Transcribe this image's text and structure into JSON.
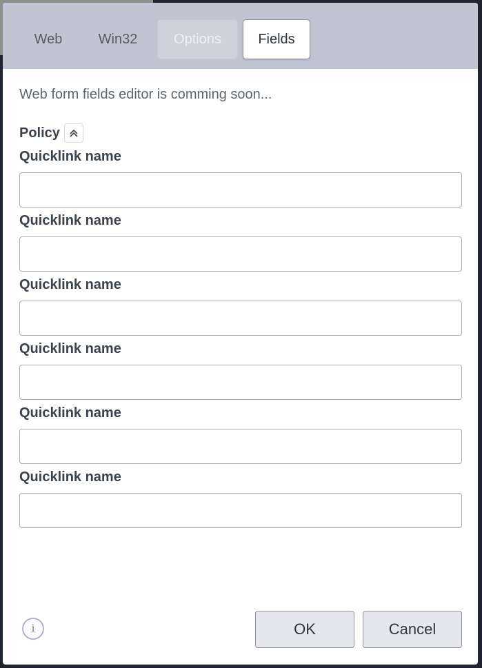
{
  "tabs": [
    {
      "label": "Web"
    },
    {
      "label": "Win32"
    },
    {
      "label": "Options"
    },
    {
      "label": "Fields"
    }
  ],
  "notice": "Web form fields editor is comming soon...",
  "policy": {
    "label": "Policy",
    "collapse_icon": "chevrons-up-icon"
  },
  "fields": [
    {
      "label": "Quicklink name",
      "value": ""
    },
    {
      "label": "Quicklink name",
      "value": ""
    },
    {
      "label": "Quicklink name",
      "value": ""
    },
    {
      "label": "Quicklink name",
      "value": ""
    },
    {
      "label": "Quicklink name",
      "value": ""
    },
    {
      "label": "Quicklink name",
      "value": ""
    }
  ],
  "footer": {
    "info_icon": "info-icon",
    "info_glyph": "i",
    "ok_label": "OK",
    "cancel_label": "Cancel"
  },
  "colors": {
    "tabbar": "#c1c5d3",
    "button_bg": "#e5e7ec",
    "info_ring": "#b9aed6"
  }
}
